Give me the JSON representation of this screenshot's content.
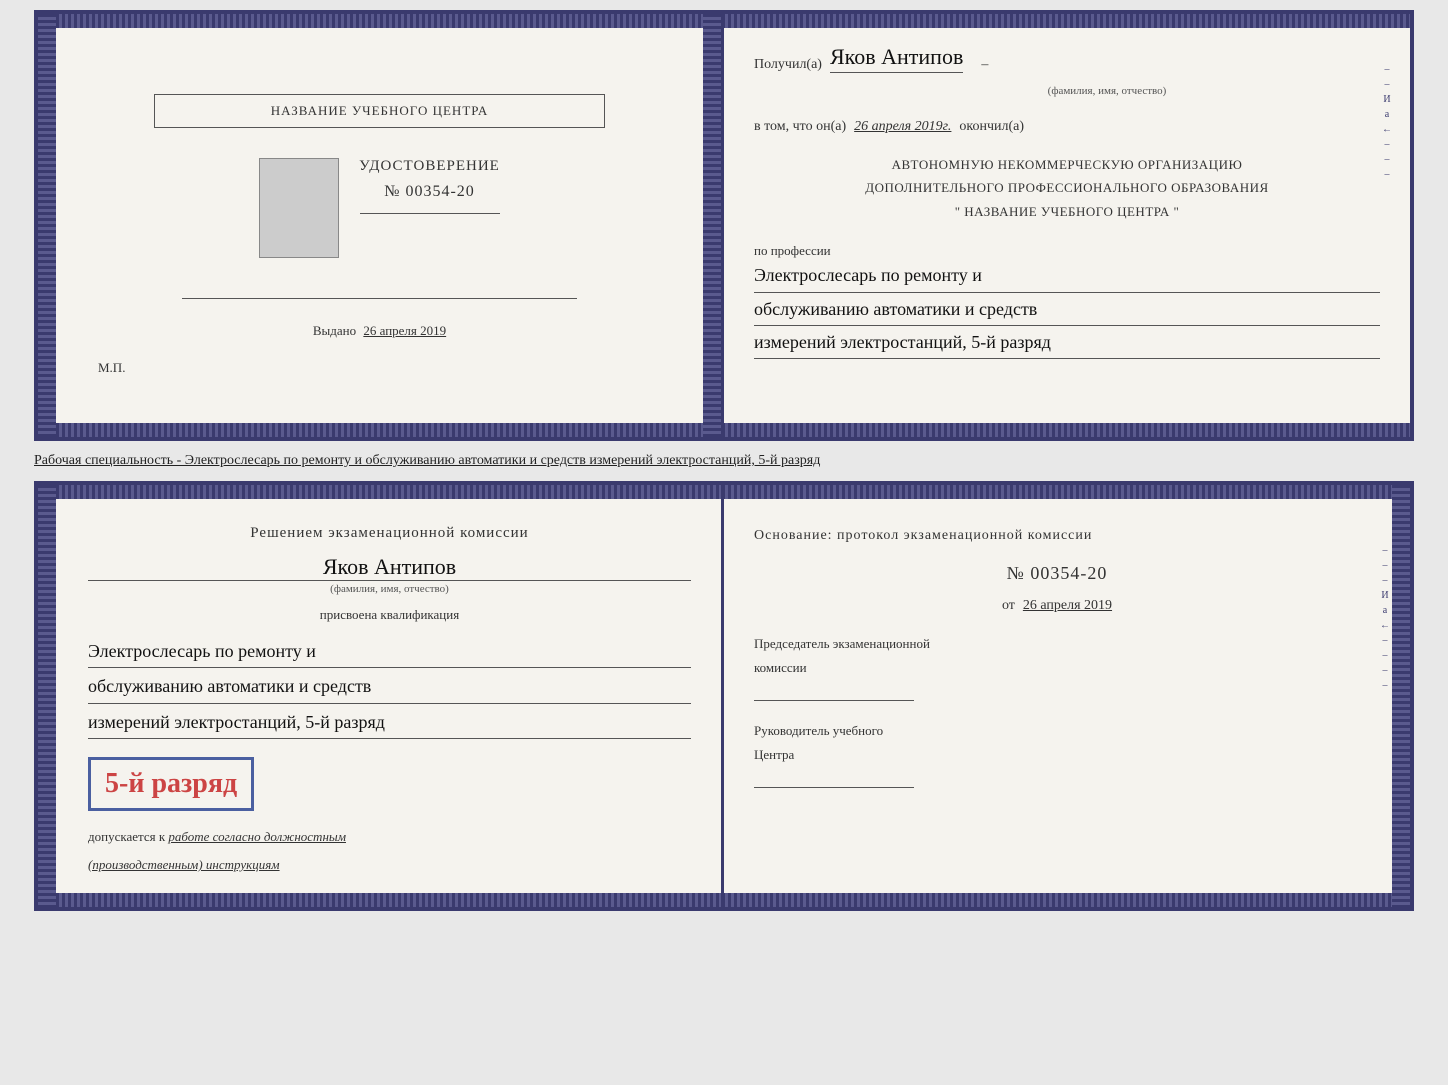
{
  "top": {
    "left": {
      "school_name": "НАЗВАНИЕ УЧЕБНОГО ЦЕНТРА",
      "cert_title": "УДОСТОВЕРЕНИЕ",
      "cert_number": "№ 00354-20",
      "issued_label": "Выдано",
      "issued_date": "26 апреля 2019",
      "mp_label": "М.П."
    },
    "right": {
      "received_label": "Получил(а)",
      "recipient_name": "Яков Антипов",
      "fio_subtitle": "(фамилия, имя, отчество)",
      "vtom_label": "в том, что он(а)",
      "vtom_date": "26 апреля 2019г.",
      "okoncil_label": "окончил(а)",
      "org_line1": "АВТОНОМНУЮ НЕКОММЕРЧЕСКУЮ ОРГАНИЗАЦИЮ",
      "org_line2": "ДОПОЛНИТЕЛЬНОГО ПРОФЕССИОНАЛЬНОГО ОБРАЗОВАНИЯ",
      "org_line3": "\"  НАЗВАНИЕ УЧЕБНОГО ЦЕНТРА  \"",
      "po_professii": "по профессии",
      "profession_line1": "Электрослесарь по ремонту и",
      "profession_line2": "обслуживанию автоматики и средств",
      "profession_line3": "измерений электростанций, 5-й разряд"
    }
  },
  "specialty_label": "Рабочая специальность - Электрослесарь по ремонту и обслуживанию автоматики и средств измерений электростанций, 5-й разряд",
  "bottom": {
    "left": {
      "commission_title": "Решением экзаменационной комиссии",
      "person_name": "Яков Антипов",
      "fio_subtitle": "(фамилия, имя, отчество)",
      "qualification_label": "присвоена квалификация",
      "profession_line1": "Электрослесарь по ремонту и",
      "profession_line2": "обслуживанию автоматики и средств",
      "profession_line3": "измерений электростанций, 5-й разряд",
      "badge_text": "5-й разряд",
      "допускается_prefix": "допускается к",
      "допускается_text": "работе согласно должностным",
      "допускается_text2": "(производственным) инструкциям"
    },
    "right": {
      "osnov_title": "Основание: протокол экзаменационной комиссии",
      "protocol_num": "№  00354-20",
      "date_prefix": "от",
      "date_value": "26 апреля 2019",
      "chairman_line1": "Председатель экзаменационной",
      "chairman_line2": "комиссии",
      "director_line1": "Руководитель учебного",
      "director_line2": "Центра"
    }
  }
}
